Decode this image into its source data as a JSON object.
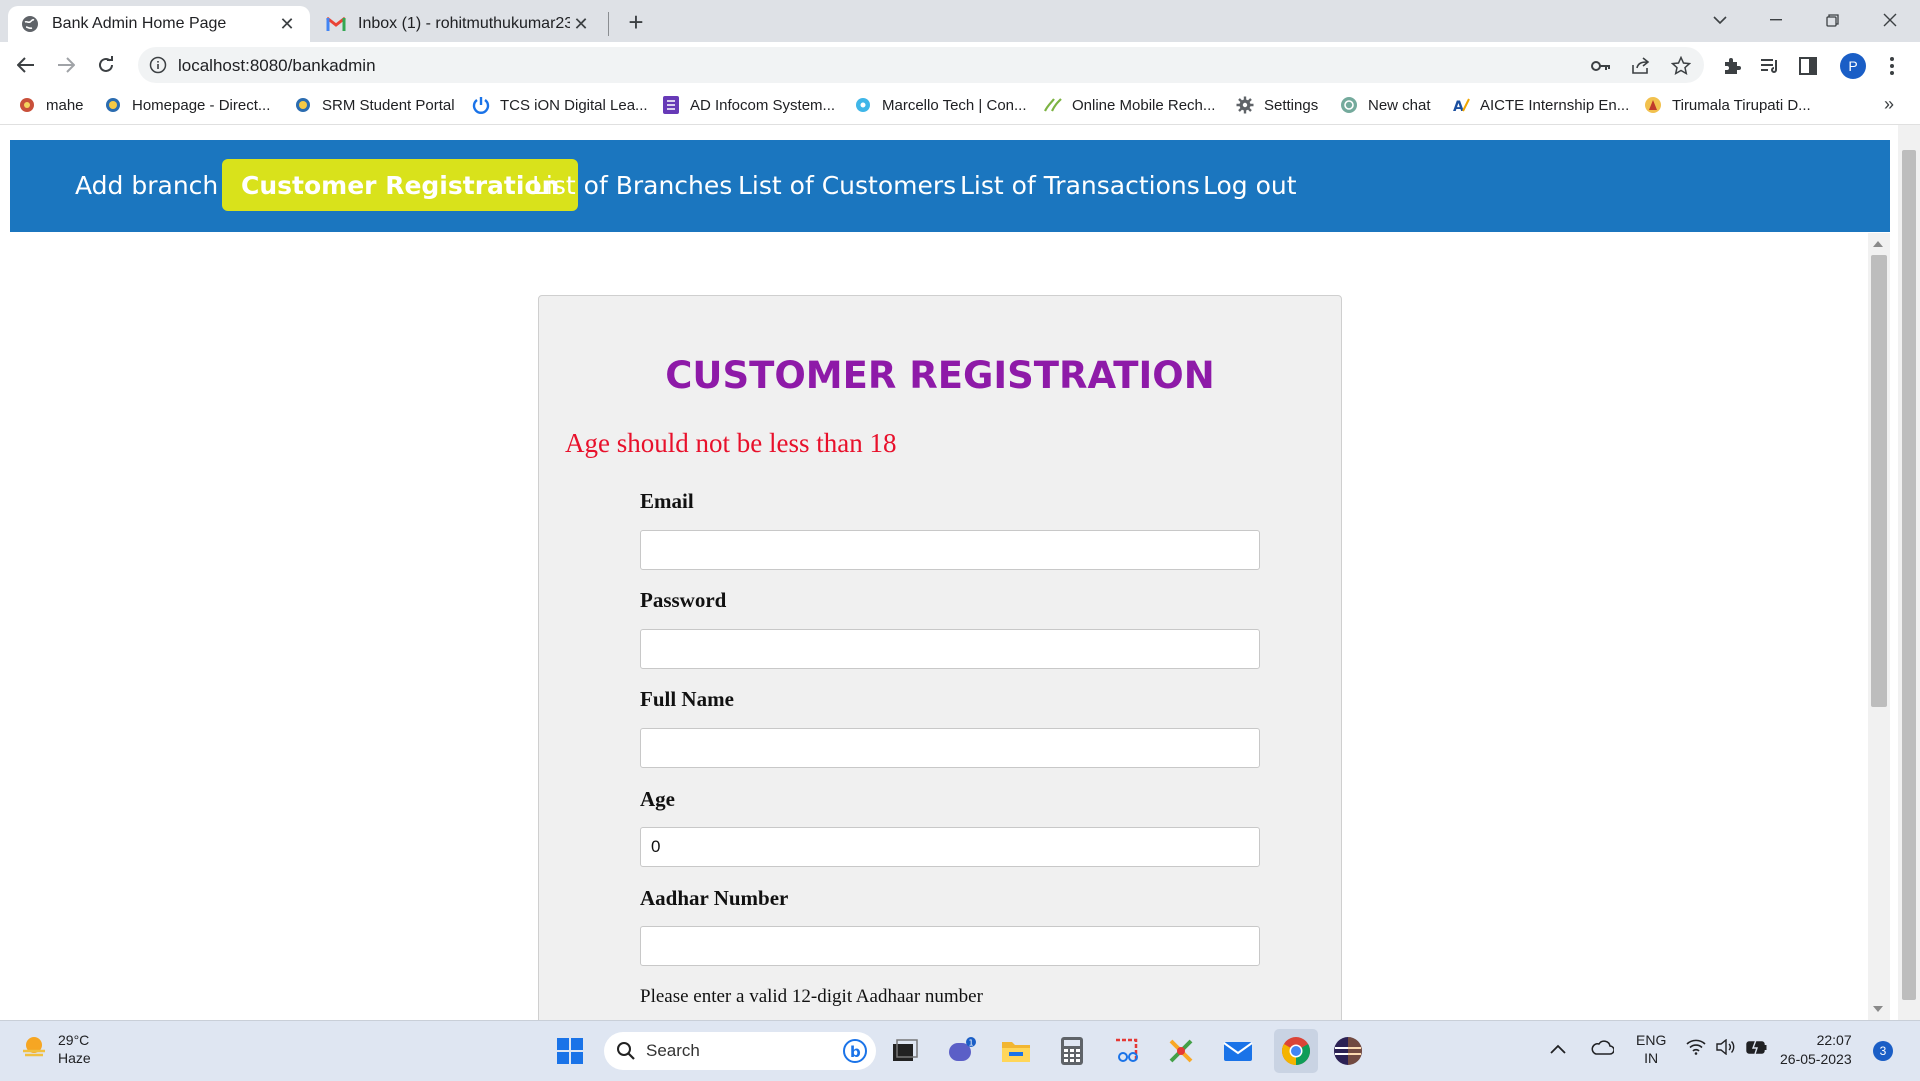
{
  "browser": {
    "tabs": [
      {
        "title": "Bank Admin Home Page",
        "active": true
      },
      {
        "title": "Inbox (1) - rohitmuthukumar23@",
        "active": false
      }
    ],
    "url": "localhost:8080/bankadmin",
    "profile_initial": "P",
    "bookmarks": [
      "mahe",
      "Homepage - Direct...",
      "SRM Student Portal",
      "TCS iON Digital Lea...",
      "AD Infocom System...",
      "Marcello Tech | Con...",
      "Online Mobile Rech...",
      "Settings",
      "New chat",
      "AICTE Internship En...",
      "Tirumala Tirupati D..."
    ],
    "bookmarks_more": "»"
  },
  "nav": {
    "items": [
      {
        "label": "Add branch",
        "active": false
      },
      {
        "label": "Customer Registration",
        "active": true
      },
      {
        "label": "List of Branches",
        "active": false
      },
      {
        "label": "List of Customers",
        "active": false
      },
      {
        "label": "List of Transactions",
        "active": false
      },
      {
        "label": "Log out",
        "active": false
      }
    ],
    "bg_color": "#1b76bf",
    "active_color": "#d9e21b"
  },
  "form": {
    "title": "CUSTOMER REGISTRATION",
    "error": "Age should not be less than 18",
    "fields": [
      {
        "label": "Email",
        "value": ""
      },
      {
        "label": "Password",
        "value": ""
      },
      {
        "label": "Full Name",
        "value": ""
      },
      {
        "label": "Age",
        "value": "0"
      },
      {
        "label": "Aadhar Number",
        "value": ""
      }
    ],
    "aadhar_hint": "Please enter a valid 12-digit Aadhaar number",
    "title_color": "#8e1aa8",
    "error_color": "#e8102b"
  },
  "taskbar": {
    "weather_temp": "29°C",
    "weather_desc": "Haze",
    "search_label": "Search",
    "chat_badge": "1",
    "lang_line1": "ENG",
    "lang_line2": "IN",
    "time": "22:07",
    "date": "26-05-2023",
    "notification_count": "3"
  }
}
